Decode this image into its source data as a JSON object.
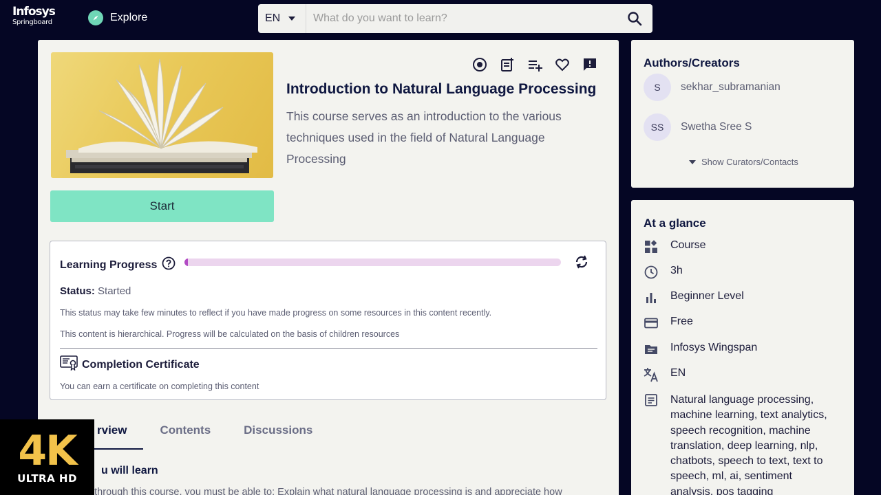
{
  "header": {
    "logo_line1": "Infosys",
    "logo_line2": "Springboard",
    "explore_label": "Explore",
    "language": "EN",
    "search_placeholder": "What do you want to learn?"
  },
  "course": {
    "title": "Introduction to Natural Language Processing",
    "description": "This course serves as an introduction to the various techniques used in the field of Natural Language Processing",
    "start_label": "Start",
    "action_icons": [
      "target-icon",
      "add-note-icon",
      "playlist-add-icon",
      "heart-icon",
      "feedback-icon"
    ]
  },
  "progress": {
    "title": "Learning Progress",
    "value": 0.01,
    "status_label": "Status:",
    "status_value": "Started",
    "note1": "This status may take few minutes to reflect if you have made progress on some resources in this content recently.",
    "note2": "This content is hierarchical. Progress will be calculated on the basis of children resources",
    "certificate_title": "Completion Certificate",
    "certificate_note": "You can earn a certificate on completing this content"
  },
  "tabs": [
    "Overview",
    "Contents",
    "Discussions"
  ],
  "tab_visible_labels": [
    "rview",
    "Contents",
    "Discussions"
  ],
  "overview": {
    "heading_visible": "u will learn",
    "text_visible": "ng through this course, you must be able to: Explain what natural language processing is and appreciate how"
  },
  "authors": {
    "heading": "Authors/Creators",
    "items": [
      {
        "initials": "S",
        "name": "sekhar_subramanian"
      },
      {
        "initials": "SS",
        "name": "Swetha Sree S"
      }
    ],
    "show_curators": "Show Curators/Contacts"
  },
  "glance": {
    "heading": "At a glance",
    "type": "Course",
    "duration": "3h",
    "level": "Beginner Level",
    "cost": "Free",
    "source": "Infosys Wingspan",
    "language": "EN",
    "tags": "Natural language processing, machine learning, text analytics, speech recognition, machine translation, deep learning, nlp, chatbots, speech to text, text to speech, ml, ai, sentiment analysis, pos tagging"
  },
  "badge": {
    "big": "4K",
    "small": "ULTRA HD"
  },
  "colors": {
    "background": "#050624",
    "start_button": "#7fe4c4",
    "progress_fill": "#b24bc4",
    "progress_track": "#ecd5ee"
  }
}
